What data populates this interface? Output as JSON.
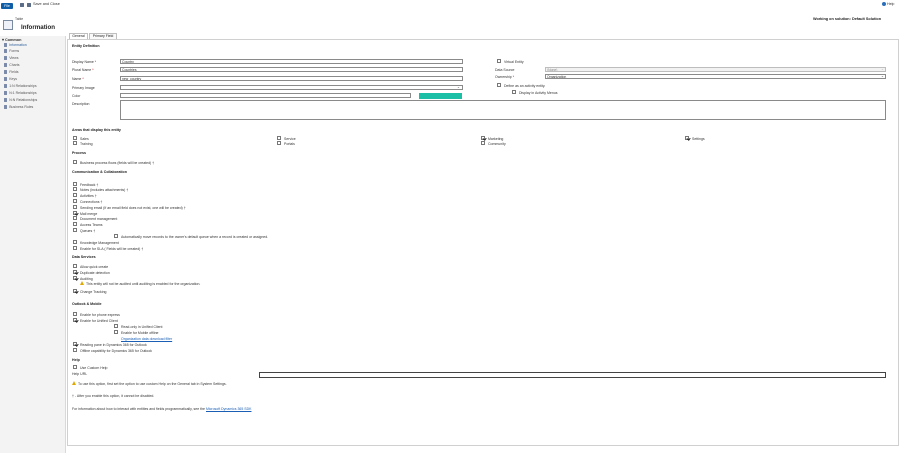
{
  "toolbar": {
    "file": "File",
    "save_close": "Save and Close",
    "help": "Help"
  },
  "header": {
    "entity_small": "Table",
    "title": "Information",
    "working_on": "Working on solution: Default Solution"
  },
  "sidebar": {
    "section": "Common",
    "items": [
      "Information",
      "Forms",
      "Views",
      "Charts",
      "Fields",
      "Keys",
      "1:N Relationships",
      "N:1 Relationships",
      "N:N Relationships",
      "Business Rules"
    ]
  },
  "tabs": [
    "General",
    "Primary Field"
  ],
  "entity_definition": {
    "title": "Entity Definition",
    "display_name_label": "Display Name",
    "display_name": "Country",
    "plural_name_label": "Plural Name",
    "plural_name": "Countries",
    "name_label": "Name",
    "name": "new_country",
    "primary_image_label": "Primary Image",
    "color_label": "Color",
    "description_label": "Description",
    "virtual_entity": "Virtual Entity",
    "data_source_label": "Data Source",
    "data_source": "(None)",
    "ownership_label": "Ownership",
    "ownership": "Organization",
    "define_activity": "Define as an activity entity.",
    "display_activity_menus": "Display in Activity Menus"
  },
  "areas": {
    "title": "Areas that display this entity",
    "items": [
      {
        "label": "Sales",
        "checked": false
      },
      {
        "label": "Service",
        "checked": false
      },
      {
        "label": "Marketing",
        "checked": true
      },
      {
        "label": "Settings",
        "checked": true
      },
      {
        "label": "Training",
        "checked": false
      },
      {
        "label": "Portals",
        "checked": false
      },
      {
        "label": "Community",
        "checked": false
      }
    ]
  },
  "process": {
    "title": "Process",
    "business_process_flows": "Business process flows (fields will be created) †"
  },
  "communication": {
    "title": "Communication & Collaboration",
    "items": [
      {
        "label": "Feedback †",
        "checked": false
      },
      {
        "label": "Notes (includes attachments) †",
        "checked": false
      },
      {
        "label": "Activities †",
        "checked": false
      },
      {
        "label": "Connections †",
        "checked": false
      },
      {
        "label": "Sending email (If an email field does not exist, one will be created) †",
        "checked": false
      },
      {
        "label": "Mail merge",
        "checked": true
      },
      {
        "label": "Document management",
        "checked": false
      },
      {
        "label": "Access Teams",
        "checked": false
      },
      {
        "label": "Queues †",
        "checked": false
      }
    ],
    "auto_move": "Automatically move records to the owner's default queue when a record is created or assigned.",
    "knowledge_management": "Knowledge Management",
    "enable_sla": "Enable for SLA ( Fields will be created) †"
  },
  "data_services": {
    "title": "Data Services",
    "allow_quick_create": "Allow quick create",
    "duplicate_detection": "Duplicate detection",
    "auditing": "Auditing",
    "auditing_warning": "This entity will not be audited until auditing is enabled for the organization.",
    "change_tracking": "Change Tracking"
  },
  "outlook_mobile": {
    "title": "Outlook & Mobile",
    "enable_phone_express": "Enable for phone express",
    "enable_unified_client": "Enable for Unified Client",
    "read_only_unified": "Read-only in Unified Client",
    "enable_mobile_offline": "Enable for Mobile offline",
    "org_data_filter": "Organization data download filter",
    "reading_pane": "Reading pane in Dynamics 365 for Outlook",
    "offline_capability": "Offline capability for Dynamics 365 for Outlook"
  },
  "help_section": {
    "title": "Help",
    "use_custom_help": "Use Custom Help",
    "help_url_label": "Help URL",
    "warning": "To use this option, first set the option to use custom Help on the General tab in System Settings.",
    "dagger_note": "† - After you enable this option, it cannot be disabled.",
    "sdk_note": "For information about how to interact with entities and fields programmatically, see the",
    "sdk_link": "Microsoft Dynamics 365 SDK"
  }
}
